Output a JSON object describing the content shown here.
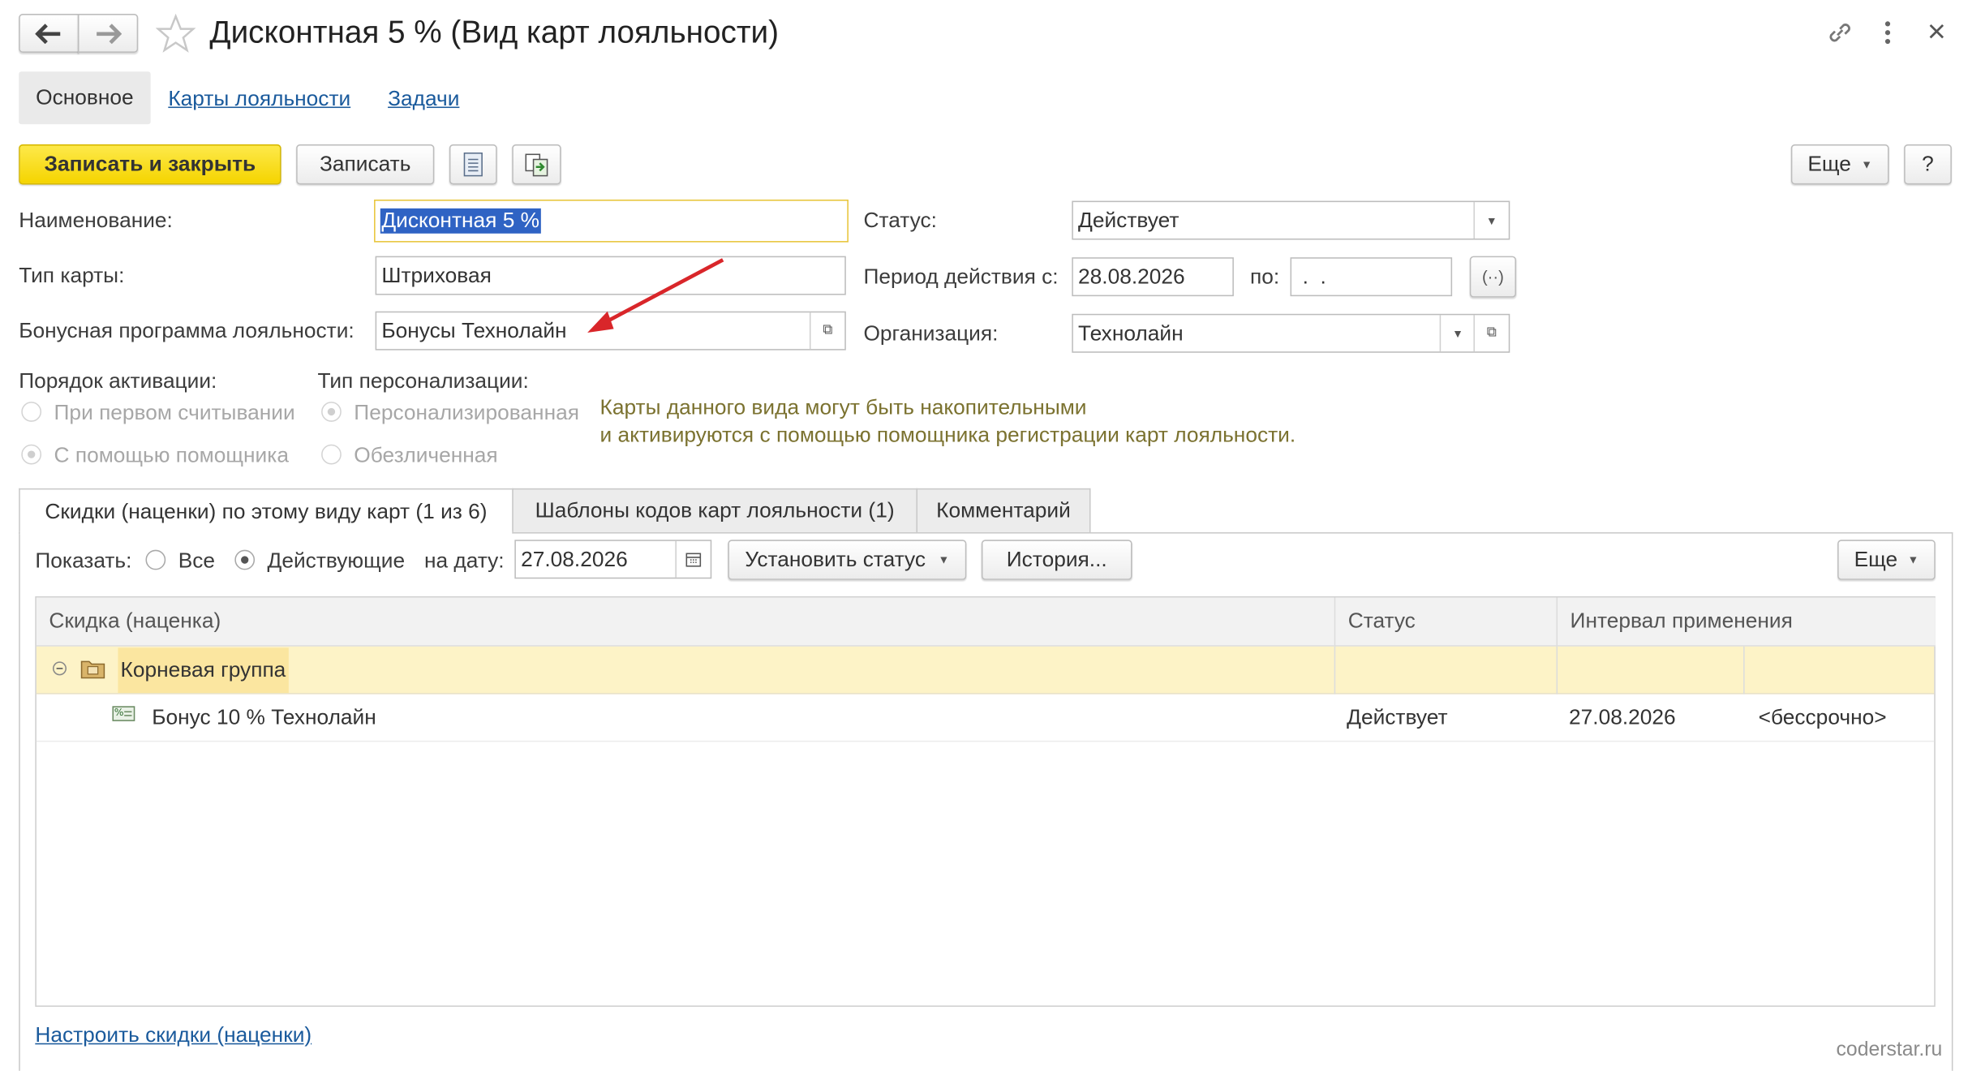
{
  "window": {
    "title": "Дисконтная 5 % (Вид карт лояльности)"
  },
  "nav_tabs": {
    "main": "Основное",
    "cards": "Карты лояльности",
    "tasks": "Задачи"
  },
  "toolbar": {
    "save_close": "Записать и закрыть",
    "save": "Записать",
    "more": "Еще",
    "help": "?"
  },
  "form": {
    "name_label": "Наименование:",
    "name_value": "Дисконтная 5 %",
    "type_label": "Тип карты:",
    "type_value": "Штриховая",
    "bonus_label": "Бонусная программа лояльности:",
    "bonus_value": "Бонусы Технолайн",
    "status_label": "Статус:",
    "status_value": "Действует",
    "period_label": "Период действия с:",
    "period_from": "28.08.2026",
    "period_to_label": "по:",
    "period_to": " .  .",
    "org_label": "Организация:",
    "org_value": "Технолайн"
  },
  "activation": {
    "label": "Порядок активации:",
    "option1": "При первом считывании",
    "option2": "С помощью помощника"
  },
  "personalization": {
    "label": "Тип персонализации:",
    "option1": "Персонализированная",
    "option2": "Обезличенная"
  },
  "info": {
    "line1": "Карты данного вида могут быть накопительными",
    "line2": "и активируются с помощью помощника регистрации карт лояльности."
  },
  "tabs": {
    "discounts": "Скидки (наценки) по этому виду карт (1 из 6)",
    "templates": "Шаблоны кодов карт лояльности (1)",
    "comment": "Комментарий"
  },
  "filter": {
    "show_label": "Показать:",
    "all": "Все",
    "active": "Действующие",
    "date_label": "на дату:",
    "date_value": "27.08.2026",
    "set_status": "Установить статус",
    "history": "История...",
    "more": "Еще"
  },
  "grid": {
    "col_discount": "Скидка (наценка)",
    "col_status": "Статус",
    "col_interval": "Интервал применения",
    "group_row": "Корневая группа",
    "rows": [
      {
        "name": "Бонус 10 % Технолайн",
        "status": "Действует",
        "from": "27.08.2026",
        "to": "<бессрочно>"
      }
    ]
  },
  "footer": {
    "configure_link": "Настроить скидки (наценки)",
    "watermark": "coderstar.ru"
  },
  "colors": {
    "accent_yellow": "#f5d400",
    "link_blue": "#1a5a9c",
    "group_row_bg": "#fdf3c7",
    "info_text": "#7b7230",
    "arrow_red": "#d9262a"
  }
}
